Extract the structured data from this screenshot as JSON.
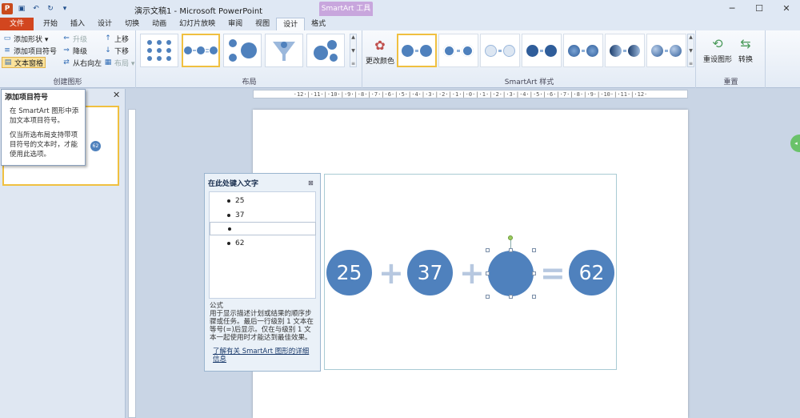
{
  "window": {
    "title": "演示文稿1 - Microsoft PowerPoint",
    "context_group": "SmartArt 工具",
    "controls": [
      "─",
      "☐",
      "✕"
    ]
  },
  "qat": {
    "app_icon": "P"
  },
  "tabs": [
    "文件",
    "开始",
    "插入",
    "设计",
    "切换",
    "动画",
    "幻灯片放映",
    "审阅",
    "视图",
    "设计",
    "格式"
  ],
  "ribbon": {
    "create": {
      "label": "创建图形",
      "add_shape": "添加形状 ▾",
      "add_bullet": "添加项目符号",
      "text_pane": "文本窗格",
      "promote": "升级",
      "demote": "降级",
      "rtl": "从右向左",
      "move_up": "上移",
      "move_down": "下移",
      "layout": "布局 ▾"
    },
    "layout_label": "布局",
    "styles": {
      "label": "SmartArt 样式",
      "change_colors": "更改颜色"
    },
    "reset": {
      "label": "重置",
      "reset_graphic": "重设图形",
      "convert": "转换"
    }
  },
  "tooltip": {
    "title": "添加项目符号",
    "line1": "在 SmartArt 图形中添加文本项目符号。",
    "line2": "仅当所选布局支持带项目符号的文本时，才能使用此选项。"
  },
  "thumb": {
    "value": "62"
  },
  "ruler": {
    "h": "·12·|·11·|·10·|·9·|·8·|·7·|·6·|·5·|·4·|·3·|·2·|·1·|·0·|·1·|·2·|·3·|·4·|·5·|·6·|·7·|·8·|·9·|·10·|·11·|·12·"
  },
  "text_pane": {
    "title": "在此处键入文字",
    "close": "⊠",
    "items": [
      "25",
      "37",
      "",
      "62"
    ],
    "desc": "公式\n用于显示描述计划或结果的顺序步骤或任务。最后一行级别 1 文本在等号(=)后显示。仅在与级别 1 文本一起使用时才能达到最佳效果。",
    "link": "了解有关 SmartArt 图形的详细信息"
  },
  "smartart": {
    "values": [
      "25",
      "37",
      "",
      "62"
    ],
    "ops": [
      "+",
      "+",
      "="
    ]
  },
  "colors": {
    "accent": "#4f81bd",
    "file_tab": "#d2461f",
    "context": "#c8a6dd"
  }
}
